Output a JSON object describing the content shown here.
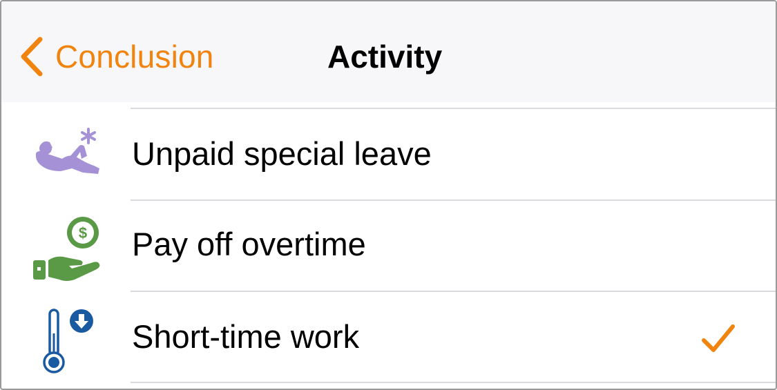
{
  "navbar": {
    "back_label": "Conclusion",
    "title": "Activity"
  },
  "rows": [
    {
      "label": "Unpaid special leave",
      "icon": "reclining-person-icon",
      "selected": false
    },
    {
      "label": "Pay off overtime",
      "icon": "hand-with-dollar-coin-icon",
      "selected": false
    },
    {
      "label": "Short-time work",
      "icon": "thermometer-down-icon",
      "selected": true
    }
  ],
  "colors": {
    "accent": "#f0840f",
    "leave_icon": "#a592d6",
    "overtime_icon": "#5a9a46",
    "shorttime_icon": "#1a5aa0"
  }
}
